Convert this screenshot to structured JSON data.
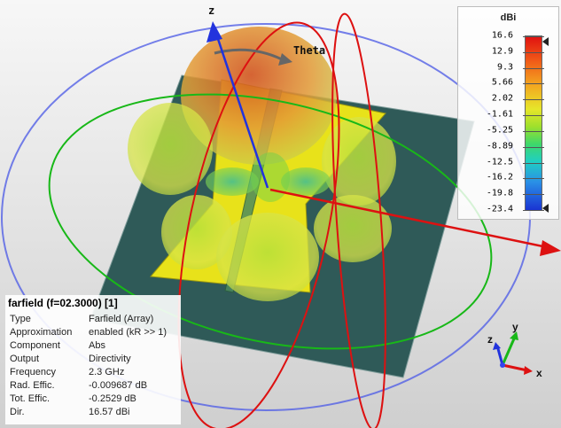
{
  "axis_labels": {
    "z": "z",
    "theta": "Theta"
  },
  "colorbar": {
    "unit": "dBi",
    "ticks": [
      "16.6",
      "12.9",
      "9.3",
      "5.66",
      "2.02",
      "-1.61",
      "-5.25",
      "-8.89",
      "-12.5",
      "-16.2",
      "-19.8",
      "-23.4"
    ]
  },
  "info": {
    "title": "farfield (f=02.3000) [1]",
    "rows": [
      {
        "key": "Type",
        "value": "Farfield (Array)"
      },
      {
        "key": "Approximation",
        "value": "enabled (kR >> 1)"
      },
      {
        "key": "Component",
        "value": "Abs"
      },
      {
        "key": "Output",
        "value": "Directivity"
      },
      {
        "key": "Frequency",
        "value": "2.3 GHz"
      },
      {
        "key": "Rad. Effic.",
        "value": "-0.009687 dB"
      },
      {
        "key": "Tot. Effic.",
        "value": "-0.2529 dB"
      },
      {
        "key": "Dir.",
        "value": "16.57 dBi"
      }
    ]
  },
  "triad": {
    "x": "x",
    "y": "y",
    "z": "z"
  },
  "colors": {
    "x_axis": "#dd1111",
    "y_axis": "#18b818",
    "z_axis": "#2233dd",
    "ground_plane": "#2f5a58",
    "patch": "#e8e21a"
  }
}
